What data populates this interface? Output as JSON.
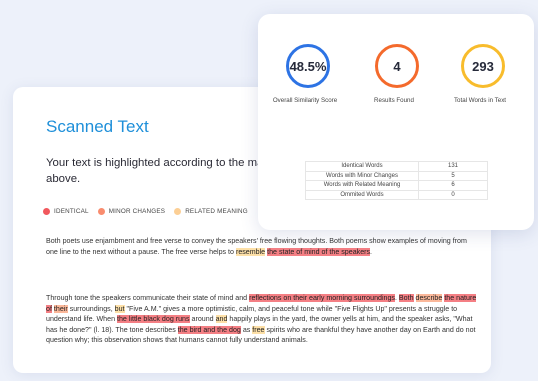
{
  "colors": {
    "accent": "#1e8fd9",
    "identical": "#f1585d",
    "minor_changes": "#f98c6e",
    "related_meaning": "#fccf95",
    "similarity_ring": "#2d73e4",
    "results_ring": "#f46a2c",
    "words_ring": "#f8bc2c"
  },
  "document": {
    "title": "Scanned Text",
    "intro_line1": "Your text is highlighted according to the ma",
    "intro_line2": "above.",
    "legend": [
      {
        "label": "IDENTICAL",
        "color": "#f1585d"
      },
      {
        "label": "MINOR CHANGES",
        "color": "#f98c6e"
      },
      {
        "label": "RELATED MEANING",
        "color": "#fccf95"
      }
    ],
    "paragraph1": [
      {
        "text": "Both poets use enjambment and free verse to convey the speakers' free flowing thoughts. Both poems show examples of moving from one line to the next without a pause. The free verse helps to "
      },
      {
        "text": "resemble",
        "hl": "yellow"
      },
      {
        "text": " "
      },
      {
        "text": "the state of mind of the speakers",
        "hl": "red"
      },
      {
        "text": "."
      }
    ],
    "paragraph2": [
      {
        "text": "Through tone the speakers communicate their state of mind and "
      },
      {
        "text": "reflections on their early morning surroundings",
        "hl": "red"
      },
      {
        "text": ". "
      },
      {
        "text": "Both",
        "hl": "red"
      },
      {
        "text": " "
      },
      {
        "text": "describe",
        "hl": "orange"
      },
      {
        "text": " "
      },
      {
        "text": "the nature of",
        "hl": "red"
      },
      {
        "text": " "
      },
      {
        "text": "their",
        "hl": "orange"
      },
      {
        "text": " surroundings, "
      },
      {
        "text": "but",
        "hl": "yellow"
      },
      {
        "text": " \"Five A.M.\" gives a more optimistic, calm, and peaceful tone while \"Five Flights Up\" presents a struggle to understand life. When "
      },
      {
        "text": "the little black dog runs",
        "hl": "red"
      },
      {
        "text": " around "
      },
      {
        "text": "and",
        "hl": "yellow"
      },
      {
        "text": " happily plays in the yard, the owner yells at him, and the speaker asks, \"What has he done?\" (l. 18). The tone describes "
      },
      {
        "text": "the bird and the dog",
        "hl": "red"
      },
      {
        "text": " as "
      },
      {
        "text": "free",
        "hl": "yellow"
      },
      {
        "text": " spirits who are thankful they have another day on Earth and do not question why; this observation shows that humans cannot fully understand animals."
      }
    ]
  },
  "stats": {
    "similarity": {
      "value": "48.5%",
      "label": "Overall Similarity Score"
    },
    "results": {
      "value": "4",
      "label": "Results Found"
    },
    "words": {
      "value": "293",
      "label": "Total Words in Text"
    },
    "table": [
      {
        "label": "Identical Words",
        "count": "131"
      },
      {
        "label": "Words with Minor Changes",
        "count": "5"
      },
      {
        "label": "Words with Related Meaning",
        "count": "6"
      },
      {
        "label": "Ommited Words",
        "count": "0"
      }
    ]
  }
}
